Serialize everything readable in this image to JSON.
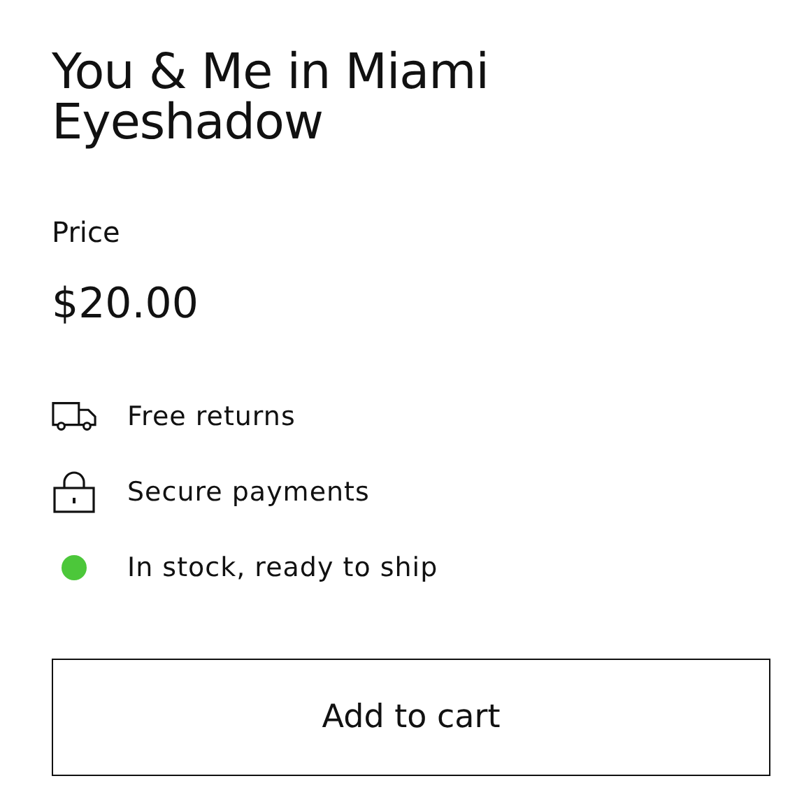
{
  "product": {
    "title": "You & Me in Miami Eyeshadow",
    "price_label": "Price",
    "price": "$20.00"
  },
  "features": [
    {
      "kind": "truck",
      "label": "Free returns"
    },
    {
      "kind": "lock",
      "label": "Secure payments"
    },
    {
      "kind": "status",
      "label": "In stock, ready to ship",
      "color": "#4cc73a"
    }
  ],
  "button": {
    "label": "Add to cart"
  }
}
